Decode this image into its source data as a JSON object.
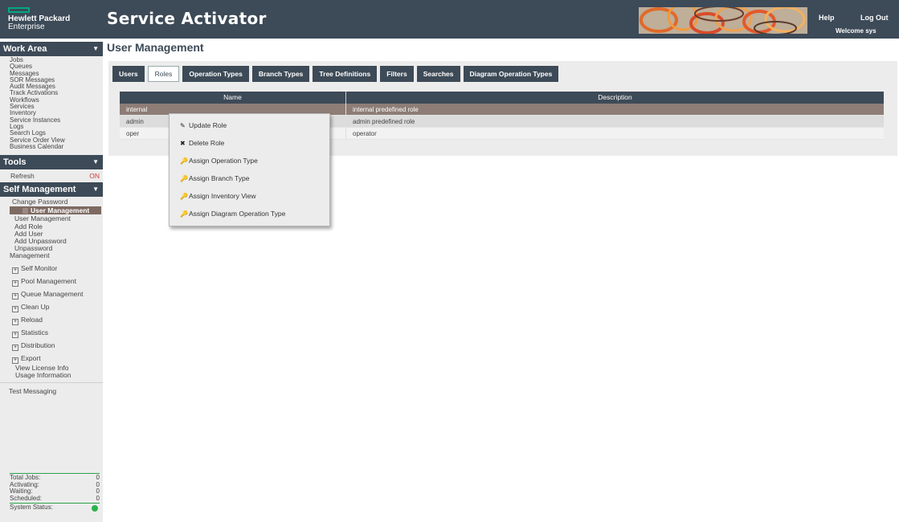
{
  "header": {
    "logo_line1": "Hewlett Packard",
    "logo_line2": "Enterprise",
    "app_title": "Service Activator",
    "help": "Help",
    "logout": "Log Out",
    "welcome": "Welcome sys"
  },
  "sidebar": {
    "work_area": {
      "title": "Work Area",
      "items": [
        "Jobs",
        "Queues",
        "Messages",
        "SOR Messages",
        "Audit Messages",
        "Track Activations",
        "Workflows",
        "Services",
        "Inventory",
        "Service Instances",
        "Logs",
        "Search Logs",
        "Service Order View",
        "Business Calendar"
      ]
    },
    "tools": {
      "title": "Tools",
      "refresh_label": "Refresh",
      "refresh_state": "ON"
    },
    "self_management": {
      "title": "Self Management",
      "change_password": "Change Password",
      "active_item": "User Management",
      "sub_items": [
        "User Management",
        "Add Role",
        "Add User",
        "Add Unpassword",
        "Unpassword Management"
      ],
      "expandable": [
        "Self Monitor",
        "Pool Management",
        "Queue Management",
        "Clean Up",
        "Reload",
        "Statistics",
        "Distribution",
        "Export"
      ],
      "license": "View License Info",
      "usage": "Usage Information",
      "test_messaging": "Test Messaging"
    },
    "stats": [
      {
        "label": "Total Jobs:",
        "value": "0"
      },
      {
        "label": "Activating:",
        "value": "0"
      },
      {
        "label": "Waiting:",
        "value": "0"
      },
      {
        "label": "Scheduled:",
        "value": "0"
      }
    ],
    "system_status_label": "System Status:"
  },
  "main": {
    "page_title": "User Management",
    "tabs": [
      "Users",
      "Roles",
      "Operation Types",
      "Branch Types",
      "Tree Definitions",
      "Filters",
      "Searches",
      "Diagram Operation Types"
    ],
    "active_tab": "Roles",
    "columns": [
      "Name",
      "Description"
    ],
    "rows": [
      {
        "name": "internal",
        "description": "internal predefined role"
      },
      {
        "name": "admin",
        "description": "admin predefined role"
      },
      {
        "name": "oper",
        "description": "operator"
      }
    ]
  },
  "context_menu": {
    "items": [
      {
        "label": "Update Role",
        "icon": "pencil-icon"
      },
      {
        "label": "Delete Role",
        "icon": "x-icon"
      },
      {
        "label": "Assign Operation Type",
        "icon": "key-icon"
      },
      {
        "label": "Assign Branch Type",
        "icon": "key-icon"
      },
      {
        "label": "Assign Inventory View",
        "icon": "key-icon"
      },
      {
        "label": "Assign Diagram Operation Type",
        "icon": "key-icon"
      }
    ]
  },
  "colors": {
    "header_bg": "#3d4a57",
    "hpe_green": "#01a982",
    "selected_row": "#8d7d76",
    "status_ok": "#2bb24c",
    "refresh_on": "#d23a3a"
  }
}
